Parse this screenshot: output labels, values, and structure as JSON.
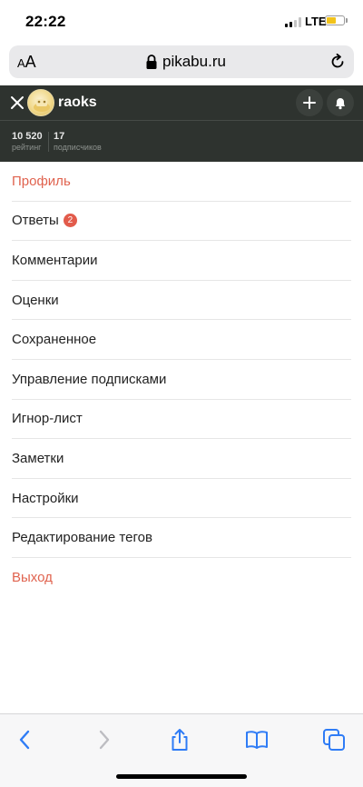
{
  "status_bar": {
    "time": "22:22",
    "network": "LTE",
    "battery_level": 0.6,
    "signal_bars_active": 2,
    "signal_bars_total": 4
  },
  "address_bar": {
    "text_size_button": "AA",
    "url": "pikabu.ru"
  },
  "header": {
    "username": "raoks",
    "stats": [
      {
        "value": "10 520",
        "label": "рейтинг"
      },
      {
        "value": "17",
        "label": "подписчиков"
      }
    ]
  },
  "menu": {
    "items": [
      {
        "label": "Профиль",
        "accent": true
      },
      {
        "label": "Ответы",
        "badge": "2"
      },
      {
        "label": "Комментарии"
      },
      {
        "label": "Оценки"
      },
      {
        "label": "Сохраненное"
      },
      {
        "label": "Управление подписками"
      },
      {
        "label": "Игнор-лист"
      },
      {
        "label": "Заметки"
      },
      {
        "label": "Настройки"
      },
      {
        "label": "Редактирование тегов"
      },
      {
        "label": "Выход",
        "accent": true
      }
    ]
  },
  "colors": {
    "header_bg": "#2e332f",
    "accent": "#e0634f",
    "badge": "#e25b4b",
    "ios_blue": "#2f7cf6"
  }
}
